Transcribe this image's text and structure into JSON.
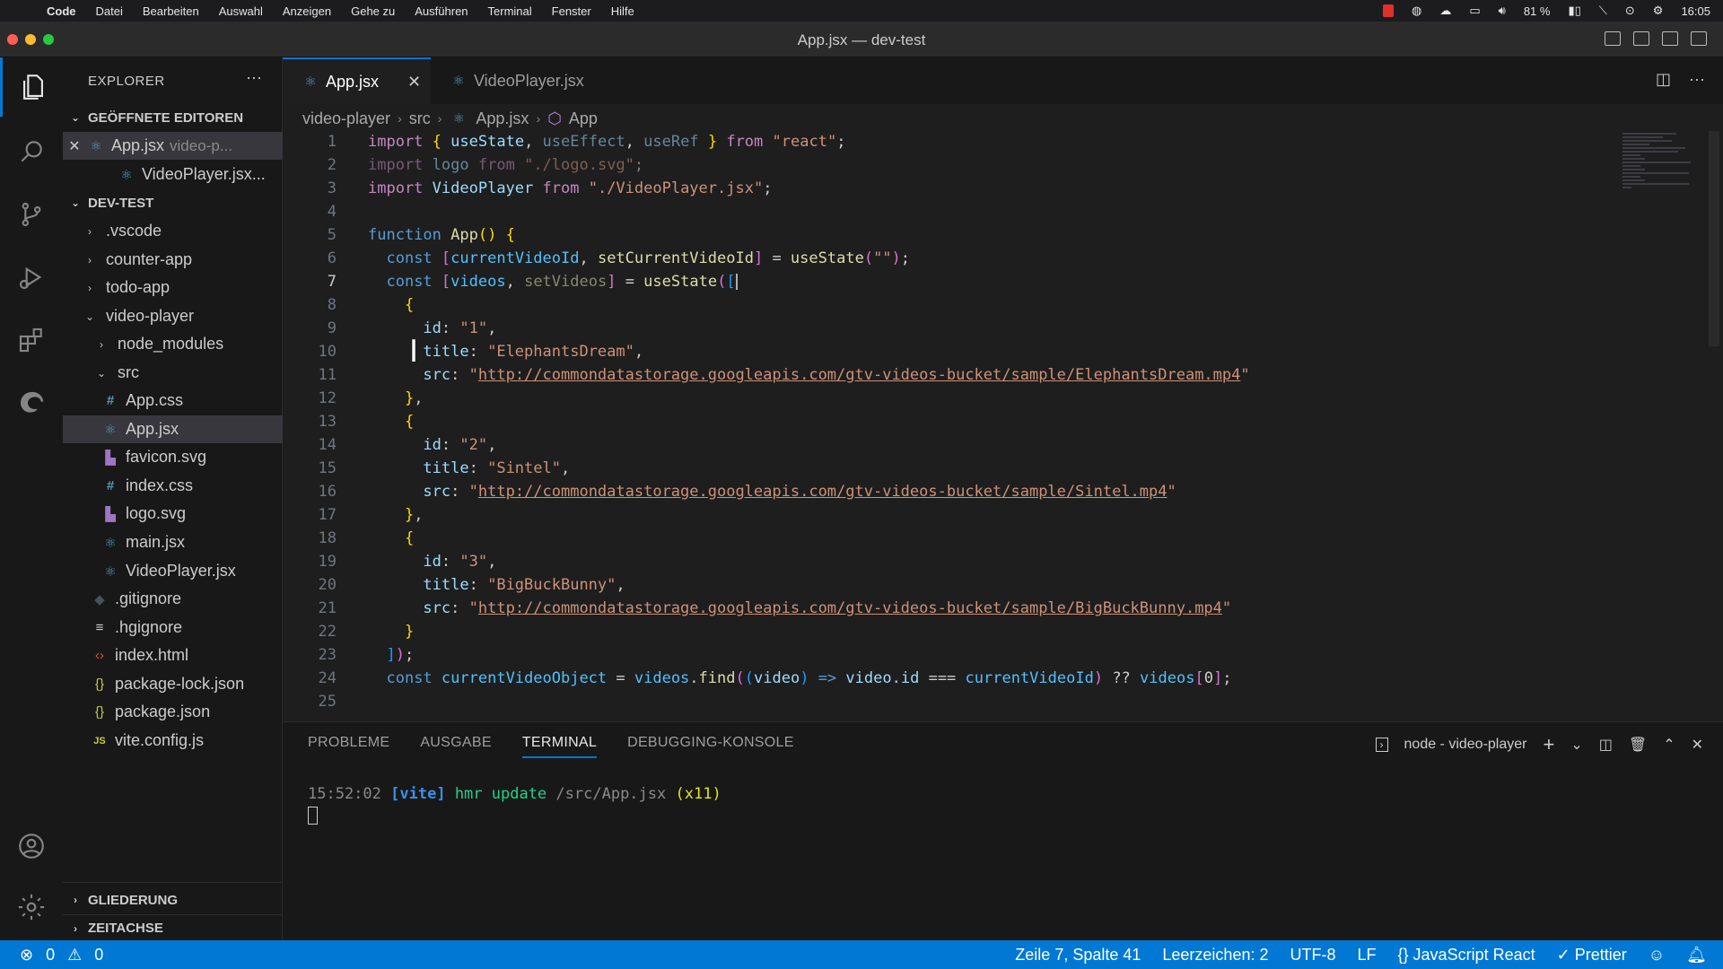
{
  "menubar": {
    "apple": "",
    "items": [
      "Code",
      "Datei",
      "Bearbeiten",
      "Auswahl",
      "Anzeigen",
      "Gehe zu",
      "Ausführen",
      "Terminal",
      "Fenster",
      "Hilfe"
    ],
    "battery": "81 %",
    "clock": "16:05"
  },
  "window": {
    "title": "App.jsx — dev-test"
  },
  "explorer": {
    "header": "EXPLORER",
    "more": "···",
    "open_editors_title": "GEÖFFNETE EDITOREN",
    "open_editors": [
      {
        "name": "App.jsx",
        "detail": "video-p..."
      },
      {
        "name": "VideoPlayer.jsx...",
        "detail": ""
      }
    ],
    "workspace_title": "DEV-TEST",
    "tree": [
      ".vscode",
      "counter-app",
      "todo-app",
      "video-player",
      "node_modules",
      "src",
      "App.css",
      "App.jsx",
      "favicon.svg",
      "index.css",
      "logo.svg",
      "main.jsx",
      "VideoPlayer.jsx",
      ".gitignore",
      ".hgignore",
      "index.html",
      "package-lock.json",
      "package.json",
      "vite.config.js"
    ],
    "outline": "GLIEDERUNG",
    "timeline": "ZEITACHSE"
  },
  "tabs": [
    {
      "label": "App.jsx"
    },
    {
      "label": "VideoPlayer.jsx"
    }
  ],
  "breadcrumb": [
    "video-player",
    "src",
    "App.jsx",
    "App"
  ],
  "code": {
    "line_numbers": [
      "1",
      "2",
      "3",
      "4",
      "5",
      "6",
      "7",
      "8",
      "9",
      "10",
      "11",
      "12",
      "13",
      "14",
      "15",
      "16",
      "17",
      "18",
      "19",
      "20",
      "21",
      "22",
      "23",
      "24",
      "25"
    ],
    "current_line": 7,
    "urls": [
      "http://commondatastorage.googleapis.com/gtv-videos-bucket/sample/ElephantsDream.mp4",
      "http://commondatastorage.googleapis.com/gtv-videos-bucket/sample/Sintel.mp4",
      "http://commondatastorage.googleapis.com/gtv-videos-bucket/sample/BigBuckBunny.mp4"
    ]
  },
  "panel": {
    "tabs": [
      "PROBLEME",
      "AUSGABE",
      "TERMINAL",
      "DEBUGGING-KONSOLE"
    ],
    "active_tab": "TERMINAL",
    "terminal_name": "node - video-player",
    "log": {
      "time": "15:52:02",
      "tag": "[vite]",
      "msg": "hmr update",
      "path": "/src/App.jsx",
      "count": "(x11)"
    }
  },
  "statusbar": {
    "errors": "0",
    "warnings": "0",
    "position": "Zeile 7, Spalte 41",
    "spaces": "Leerzeichen: 2",
    "encoding": "UTF-8",
    "eol": "LF",
    "language": "JavaScript React",
    "formatter": "Prettier"
  },
  "colors": {
    "accent": "#0078d4",
    "background": "#1e1e1e"
  }
}
